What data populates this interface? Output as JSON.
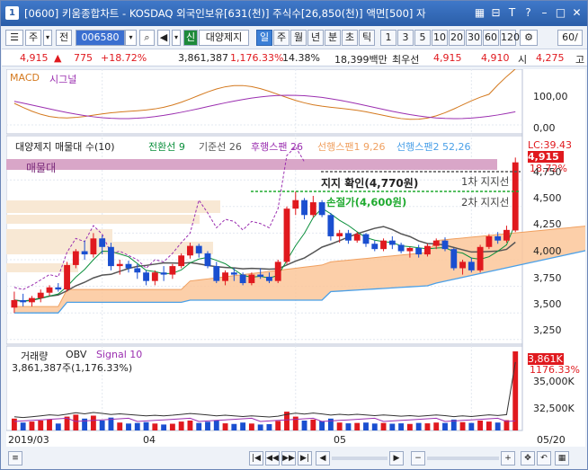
{
  "window": {
    "app_icon": "1",
    "title": "[0600] 키움종합차트 - KOSDAQ 외국인보유[631(천)] 주식수[26,850(천)] 액면[500] 자"
  },
  "toolbar": {
    "type_label": "주",
    "prev_label": "전",
    "code": "006580",
    "category_badge": "신",
    "stock_name": "대양제지",
    "periods": [
      "일",
      "주",
      "월",
      "년",
      "분",
      "초",
      "틱"
    ],
    "intervals": [
      "1",
      "3",
      "5",
      "10",
      "20",
      "30",
      "60",
      "120"
    ],
    "count": "60/"
  },
  "info": {
    "price": "4,915",
    "change": "775",
    "change_pct": "+18.72%",
    "volume": "3,861,387",
    "volume_pct": "1,176.33%",
    "turnover": "14.38%",
    "amount": "18,399백만",
    "best_ask_label": "최우선",
    "best_ask": "4,915",
    "best_bid": "4,910",
    "open_label": "시",
    "open": "4,275",
    "high_label": "고"
  },
  "macd_pane": {
    "label1": "MACD",
    "label2": "시그널",
    "axis": [
      "100,00",
      "0,00"
    ]
  },
  "price_pane": {
    "legend_title": "대양제지 매물대 수(10)",
    "legend_items": [
      {
        "label": "전환선 9",
        "color": "#0b8f3c"
      },
      {
        "label": "기준선 26",
        "color": "#555555"
      },
      {
        "label": "후행스팬 26",
        "color": "#9b2fb0"
      },
      {
        "label": "선행스팬1 9,26",
        "color": "#f0a060"
      },
      {
        "label": "선행스팬2 52,26",
        "color": "#4aa0e8"
      }
    ],
    "lc_label": "LC:39.43",
    "current_price": "4,915",
    "current_pct": "18.72%",
    "maemuldae_label": "매물대",
    "support_text": "지지 확인(4,770원)",
    "stop_text": "손절가(4,600원)",
    "support1": "1차 지지선",
    "support2": "2차 지지선",
    "axis": [
      "4,750",
      "4,500",
      "4,250",
      "4,000",
      "3,750",
      "3,500",
      "3,250"
    ]
  },
  "volume_pane": {
    "label1": "거래량",
    "label2": "OBV",
    "label3": "Signal 10",
    "volume_line": "3,861,387주(1,176.33%)",
    "badge1": "3,861K",
    "badge2": "1176.33%",
    "axis": [
      "35,000K",
      "32,500K"
    ]
  },
  "x_axis": [
    "2019/03",
    "04",
    "05",
    "05/20"
  ],
  "colors": {
    "up": "#e0191e",
    "down": "#1a4fd0",
    "title_bg": "#2b5ea8",
    "support_line": "#555555",
    "stop_line": "#1faa2f"
  },
  "chart_data": {
    "type": "candlestick",
    "ohlc": [
      [
        3550,
        3700,
        3500,
        3620
      ],
      [
        3620,
        3680,
        3560,
        3600
      ],
      [
        3600,
        3660,
        3560,
        3640
      ],
      [
        3640,
        3720,
        3600,
        3690
      ],
      [
        3690,
        3760,
        3660,
        3740
      ],
      [
        3740,
        3780,
        3700,
        3720
      ],
      [
        3720,
        3980,
        3700,
        3950
      ],
      [
        3950,
        4100,
        3920,
        4080
      ],
      [
        4080,
        4180,
        4000,
        4050
      ],
      [
        4050,
        4250,
        4020,
        4200
      ],
      [
        4200,
        4230,
        4050,
        4120
      ],
      [
        4120,
        4160,
        3900,
        3940
      ],
      [
        3940,
        4000,
        3860,
        3960
      ],
      [
        3960,
        3990,
        3880,
        3920
      ],
      [
        3920,
        3960,
        3820,
        3880
      ],
      [
        3880,
        3900,
        3760,
        3800
      ],
      [
        3800,
        3900,
        3760,
        3880
      ],
      [
        3880,
        3940,
        3800,
        3860
      ],
      [
        3860,
        3960,
        3820,
        3940
      ],
      [
        3940,
        4060,
        3920,
        4040
      ],
      [
        4040,
        4160,
        4010,
        4130
      ],
      [
        4130,
        4150,
        4020,
        4060
      ],
      [
        4060,
        4080,
        3920,
        3940
      ],
      [
        3940,
        3980,
        3780,
        3800
      ],
      [
        3800,
        3900,
        3760,
        3880
      ],
      [
        3880,
        3920,
        3800,
        3860
      ],
      [
        3860,
        3880,
        3760,
        3780
      ],
      [
        3780,
        3880,
        3760,
        3860
      ],
      [
        3860,
        3920,
        3820,
        3840
      ],
      [
        3840,
        3880,
        3780,
        3800
      ],
      [
        3800,
        4000,
        3780,
        3980
      ],
      [
        3980,
        4500,
        3960,
        4480
      ],
      [
        4480,
        4640,
        4420,
        4560
      ],
      [
        4560,
        4580,
        4380,
        4420
      ],
      [
        4420,
        4600,
        4400,
        4540
      ],
      [
        4540,
        4560,
        4400,
        4420
      ],
      [
        4420,
        4440,
        4180,
        4220
      ],
      [
        4220,
        4280,
        4160,
        4250
      ],
      [
        4250,
        4280,
        4150,
        4180
      ],
      [
        4180,
        4260,
        4160,
        4240
      ],
      [
        4240,
        4250,
        4120,
        4150
      ],
      [
        4150,
        4180,
        4080,
        4100
      ],
      [
        4100,
        4200,
        4080,
        4180
      ],
      [
        4180,
        4220,
        4100,
        4140
      ],
      [
        4140,
        4160,
        4060,
        4080
      ],
      [
        4080,
        4120,
        4020,
        4110
      ],
      [
        4110,
        4140,
        4020,
        4050
      ],
      [
        4050,
        4150,
        4030,
        4130
      ],
      [
        4130,
        4200,
        4100,
        4180
      ],
      [
        4180,
        4210,
        4080,
        4100
      ],
      [
        4100,
        4110,
        3900,
        3920
      ],
      [
        3920,
        4000,
        3860,
        3980
      ],
      [
        3980,
        4020,
        3880,
        3900
      ],
      [
        3900,
        4140,
        3880,
        4120
      ],
      [
        4120,
        4240,
        4100,
        4220
      ],
      [
        4220,
        4260,
        4150,
        4180
      ],
      [
        4180,
        4320,
        4160,
        4280
      ],
      [
        4275,
        4960,
        4260,
        4915
      ]
    ],
    "volume": [
      60,
      40,
      45,
      50,
      55,
      35,
      70,
      80,
      60,
      75,
      50,
      65,
      40,
      35,
      38,
      42,
      35,
      30,
      34,
      45,
      50,
      38,
      44,
      50,
      36,
      33,
      40,
      35,
      30,
      32,
      48,
      95,
      70,
      50,
      55,
      48,
      60,
      40,
      36,
      38,
      40,
      35,
      38,
      34,
      36,
      33,
      38,
      36,
      40,
      38,
      55,
      42,
      38,
      50,
      45,
      40,
      52,
      420
    ]
  }
}
